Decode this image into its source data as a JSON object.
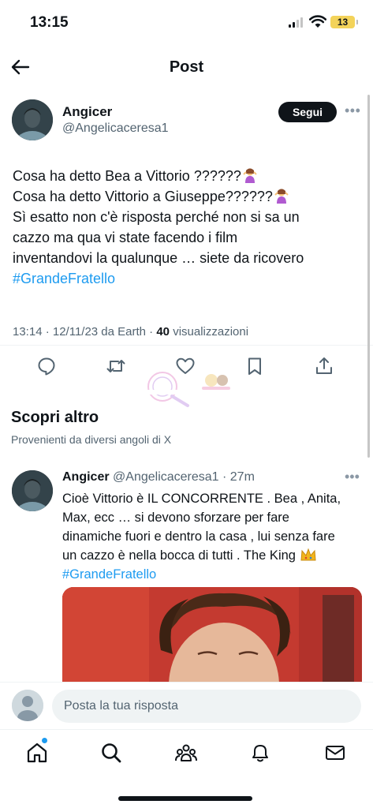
{
  "status_bar": {
    "time": "13:15",
    "battery": "13"
  },
  "header": {
    "title": "Post"
  },
  "main_post": {
    "author_name": "Angicer",
    "author_handle": "@Angelicaceresa1",
    "follow_label": "Segui",
    "lines": [
      "Cosa ha detto Bea a Vittorio ??????",
      "Cosa ha detto Vittorio a Giuseppe??????",
      "Sì esatto non c'è risposta perché non si sa un",
      "cazzo ma qua vi state facendo i film",
      "inventandovi la qualunque … siete da ricovero"
    ],
    "hashtag": "#GrandeFratello",
    "meta_prefix": "13:14 · 12/11/23 da Earth · ",
    "views_count": "40",
    "views_label": " visualizzazioni"
  },
  "discover": {
    "title": "Scopri altro",
    "subtitle": "Provenienti da diversi angoli di X"
  },
  "reply_post": {
    "author_name": "Angicer",
    "handle_time": " @Angelicaceresa1 · 27m",
    "lines": [
      "Cioè Vittorio è IL CONCORRENTE . Bea , Anita,",
      "Max, ecc …  si devono sforzare per fare",
      "dinamiche fuori e dentro la casa , lui senza fare",
      "un cazzo è nella bocca di tutti . The King "
    ],
    "hashtag": "#GrandeFratello"
  },
  "compose": {
    "placeholder": "Posta la tua risposta"
  },
  "bottom_nav": [
    "home",
    "search",
    "communities",
    "notifications",
    "messages"
  ],
  "colors": {
    "accent": "#1d9bf0",
    "text": "#0f1419",
    "secondary": "#536471"
  }
}
